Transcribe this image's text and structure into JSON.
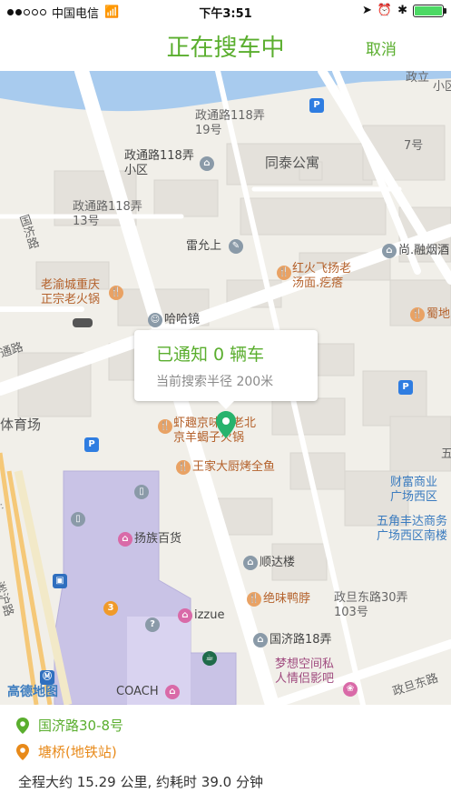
{
  "status": {
    "carrier": "中国电信",
    "time": "下午3:51"
  },
  "nav": {
    "title": "正在搜车中",
    "cancel": "取消"
  },
  "map": {
    "labels": {
      "zhengtong_118_19": "政通路118弄\n19号",
      "zhengtong_118_xiaoqu": "政通路118弄\n小区",
      "tongtai": "同泰公寓",
      "zhengtong_118_13": "政通路118弄\n13号",
      "guoji_road_v": "国济路",
      "leiyunshang": "雷允上",
      "hongwei": "红火飞扬老\n汤面.疙瘩",
      "laoyu": "老渝城重庆\n正宗老火锅",
      "shangrong": "尚.融烟酒",
      "hahajing": "哈哈镜",
      "shudi": "蜀地",
      "tongdao_road": "通路",
      "tiyuchang": "体育场",
      "xiaqu": "虾趣京味锅老北\n京羊蝎子火锅",
      "wangjia": "王家大厨烤全鱼",
      "caifu": "财富商业\n广场西区",
      "wujiao": "五角丰达商务\n广场西区南楼",
      "yangzu": "扬族百货",
      "shunda": "顺达楼",
      "juewei": "绝味鸭脖",
      "zhengdan_30": "政旦东路30弄\n103号",
      "izzue": "izzue",
      "guoji_18": "国济路18弄",
      "coach": "COACH",
      "mengxiang": "梦想空间私\n人情侣影吧",
      "zhengdan_road": "政旦东路",
      "songhu": "淞沪路",
      "zhengli": "政立",
      "xiao": "小区",
      "wu": "五",
      "num7": "7号",
      "amap": "高德地图"
    },
    "bubble": {
      "notify": "已通知 0 辆车",
      "radius": "当前搜索半径 200米"
    }
  },
  "trip": {
    "origin": "国济路30-8号",
    "destination": "塘桥(地铁站)",
    "summary": "全程大约 15.29 公里, 约耗时 39.0 分钟"
  },
  "colors": {
    "accent": "#5aae2e",
    "origin": "#5aae2e",
    "destination": "#e88a1a"
  }
}
